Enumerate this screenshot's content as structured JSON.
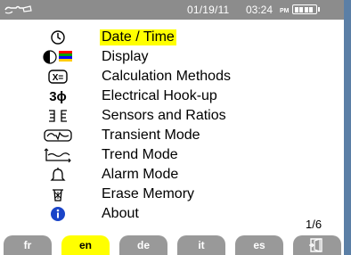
{
  "statusbar": {
    "date": "01/19/11",
    "time": "03:24",
    "ampm": "PM",
    "battery_level": 0.8
  },
  "menu": {
    "items": [
      {
        "icon": "clock-icon",
        "label": "Date / Time",
        "selected": true
      },
      {
        "icon": "display-contrast-icon",
        "label": "Display",
        "selected": false
      },
      {
        "icon": "calculator-icon",
        "label": "Calculation Methods",
        "selected": false
      },
      {
        "icon": "three-phase-icon",
        "label": "Electrical Hook-up",
        "selected": false
      },
      {
        "icon": "sensors-icon",
        "label": "Sensors and Ratios",
        "selected": false
      },
      {
        "icon": "transient-wave-icon",
        "label": "Transient Mode",
        "selected": false
      },
      {
        "icon": "trend-curve-icon",
        "label": "Trend Mode",
        "selected": false
      },
      {
        "icon": "alarm-bell-icon",
        "label": "Alarm Mode",
        "selected": false
      },
      {
        "icon": "trash-icon",
        "label": "Erase Memory",
        "selected": false
      },
      {
        "icon": "info-icon",
        "label": "About",
        "selected": false
      }
    ],
    "three_phase_symbol": "3ϕ",
    "calc_symbol": "X="
  },
  "page_indicator": "1/6",
  "languages": [
    {
      "code": "fr",
      "active": false
    },
    {
      "code": "en",
      "active": true
    },
    {
      "code": "de",
      "active": false
    },
    {
      "code": "it",
      "active": false
    },
    {
      "code": "es",
      "active": false
    }
  ],
  "colors": {
    "statusbar": "#8c8c8c",
    "selection": "#ffff00",
    "tab": "#999999",
    "info": "#1a44c8"
  }
}
